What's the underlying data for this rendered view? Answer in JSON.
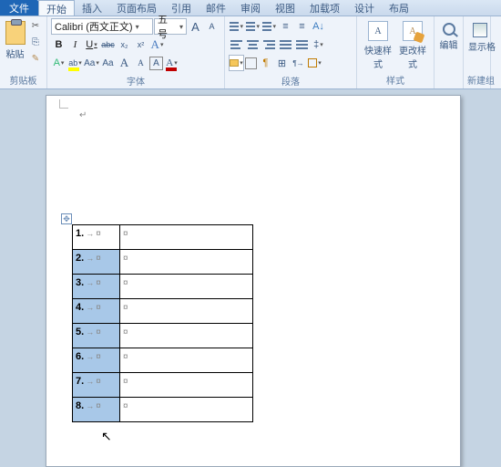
{
  "tabs": {
    "file": "文件",
    "items": [
      "开始",
      "插入",
      "页面布局",
      "引用",
      "邮件",
      "审阅",
      "视图",
      "加载项",
      "设计",
      "布局"
    ],
    "active_index": 0
  },
  "clipboard": {
    "title": "剪贴板",
    "paste": "粘贴",
    "cut_icon": "✂",
    "copy_icon": "⎘",
    "brush_icon": "✎"
  },
  "font": {
    "title": "字体",
    "name": "Calibri (西文正文)",
    "size": "五号",
    "grow": "A",
    "shrink": "A",
    "clear": "Aa",
    "bold": "B",
    "italic": "I",
    "underline": "U",
    "strike": "abc",
    "sub": "x₂",
    "sup": "x²",
    "fontcolor_label": "A",
    "text_effect": "A",
    "highlight": "ab",
    "case": "Aa",
    "phonetic": "A",
    "border": "A"
  },
  "paragraph": {
    "title": "段落"
  },
  "styles": {
    "title": "样式",
    "quick": "快速样式",
    "change": "更改样式"
  },
  "edit": {
    "title": "编辑"
  },
  "newgroup": {
    "title": "新建组",
    "show": "显示格"
  },
  "pilcrow": "↵",
  "table": {
    "rows": [
      {
        "n": "1.",
        "sel": false
      },
      {
        "n": "2.",
        "sel": true
      },
      {
        "n": "3.",
        "sel": true
      },
      {
        "n": "4.",
        "sel": true
      },
      {
        "n": "5.",
        "sel": true
      },
      {
        "n": "6.",
        "sel": true
      },
      {
        "n": "7.",
        "sel": true
      },
      {
        "n": "8.",
        "sel": true
      }
    ],
    "tab_glyph": "→",
    "cell_glyph": "¤"
  },
  "move_handle_glyph": "✥",
  "cursor_glyph": "↖"
}
